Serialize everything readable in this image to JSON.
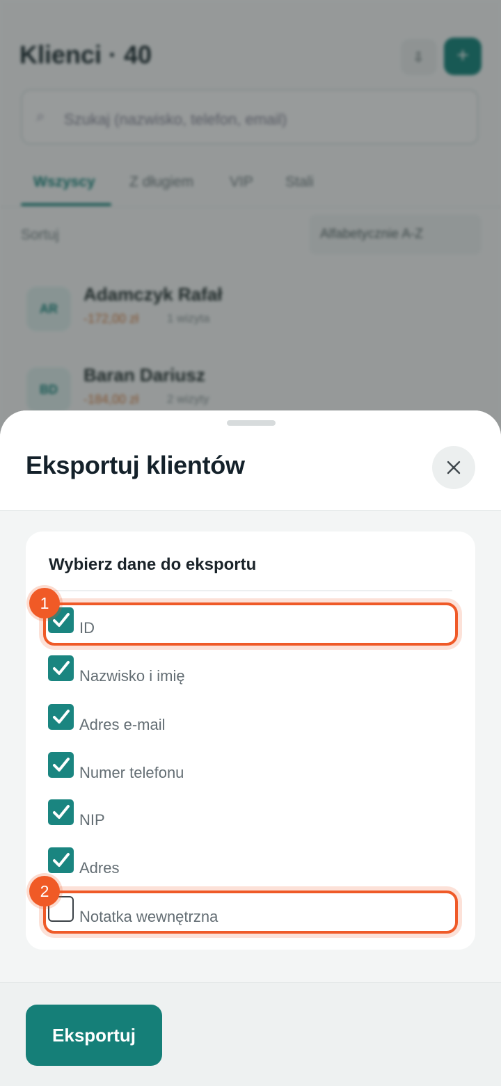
{
  "background": {
    "title": "Klienci · 40",
    "search_placeholder": "Szukaj (nazwisko, telefon, email)",
    "tabs": [
      "Wszyscy",
      "Z długiem",
      "VIP",
      "Stali"
    ],
    "sort_label": "Sortuj",
    "sort_value": "Alfabetycznie A-Z",
    "clients": [
      {
        "initials": "AR",
        "name": "Adamczyk Rafał",
        "amount": "-172,00 zł",
        "meta": "1 wizyta"
      },
      {
        "initials": "BD",
        "name": "Baran Dariusz",
        "amount": "-184,00 zł",
        "meta": "2 wizyty"
      }
    ]
  },
  "sheet": {
    "title": "Eksportuj klientów",
    "section_title": "Wybierz dane do eksportu",
    "options": [
      {
        "label": "ID",
        "checked": true
      },
      {
        "label": "Nazwisko i imię",
        "checked": true
      },
      {
        "label": "Adres e-mail",
        "checked": true
      },
      {
        "label": "Numer telefonu",
        "checked": true
      },
      {
        "label": "NIP",
        "checked": true
      },
      {
        "label": "Adres",
        "checked": true
      },
      {
        "label": "Notatka wewnętrzna",
        "checked": false
      }
    ],
    "export_label": "Eksportuj"
  },
  "annotations": {
    "marker_1": "1",
    "marker_2": "2"
  },
  "colors": {
    "accent": "#157f78",
    "highlight": "#ef5a28"
  }
}
